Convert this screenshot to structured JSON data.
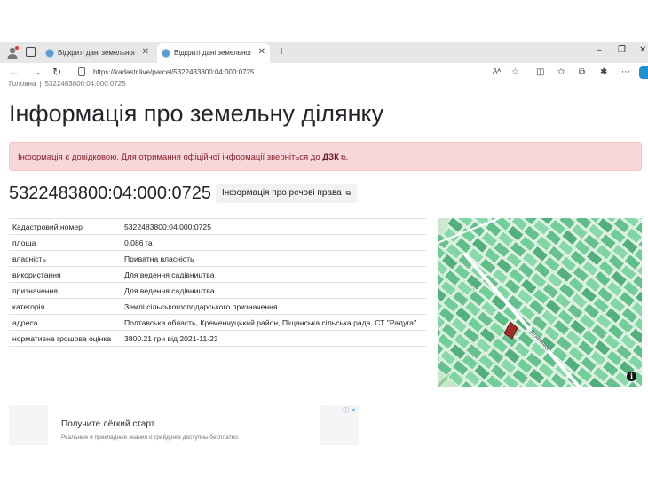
{
  "browser": {
    "tabs": [
      {
        "title": "Відкриті дані земельного кадастру",
        "active": false
      },
      {
        "title": "Відкриті дані земельного кадастру",
        "active": true
      }
    ],
    "new_tab": "+",
    "url": "https://kadastr.live/parcel/5322483800:04:000:0725",
    "read_aloud": "Aᴬ",
    "min": "–",
    "restore": "❐",
    "close": "✕"
  },
  "breadcrumb": {
    "home": "Головна",
    "separator": "|",
    "current": "5322483800:04:000:0725"
  },
  "page_title": "Інформація про земельну ділянку",
  "alert": {
    "text": "Інформація є довідковою. Для отримання офіційної інформації зверніться до ",
    "link": "ДЗК",
    "end": "."
  },
  "cadastral_number": "5322483800:04:000:0725",
  "rights_button": "Інформація про речові права",
  "table": [
    {
      "key": "Кадастровий номер",
      "value": "5322483800:04:000:0725"
    },
    {
      "key": "площа",
      "value": "0.086 га"
    },
    {
      "key": "власність",
      "value": "Приватна власність"
    },
    {
      "key": "використання",
      "value": "Для ведення садівництва"
    },
    {
      "key": "призначення",
      "value": "Для ведення садівництва"
    },
    {
      "key": "категорія",
      "value": "Землі сільськогосподарського призначення"
    },
    {
      "key": "адреса",
      "value": "Полтавська область, Кременчуцький район, Піщанська сільська рада, СТ \"Радуга\""
    },
    {
      "key": "нормативна грошова оцінка",
      "value": "3800.21 грн від 2021-11-23"
    }
  ],
  "map": {
    "street_label": "Безіменна",
    "info": "i",
    "colors": {
      "parcel": "#6fcf97",
      "highlight": "#a52a2a",
      "water": "#a8d8ea",
      "ground": "#cfe8d0"
    }
  },
  "ad": {
    "title": "Получите лёгкий старт",
    "subtitle": "Реальные и прикладные знания о трейдинге доступны бесплатно.",
    "controls": "ⓘ ✕"
  }
}
